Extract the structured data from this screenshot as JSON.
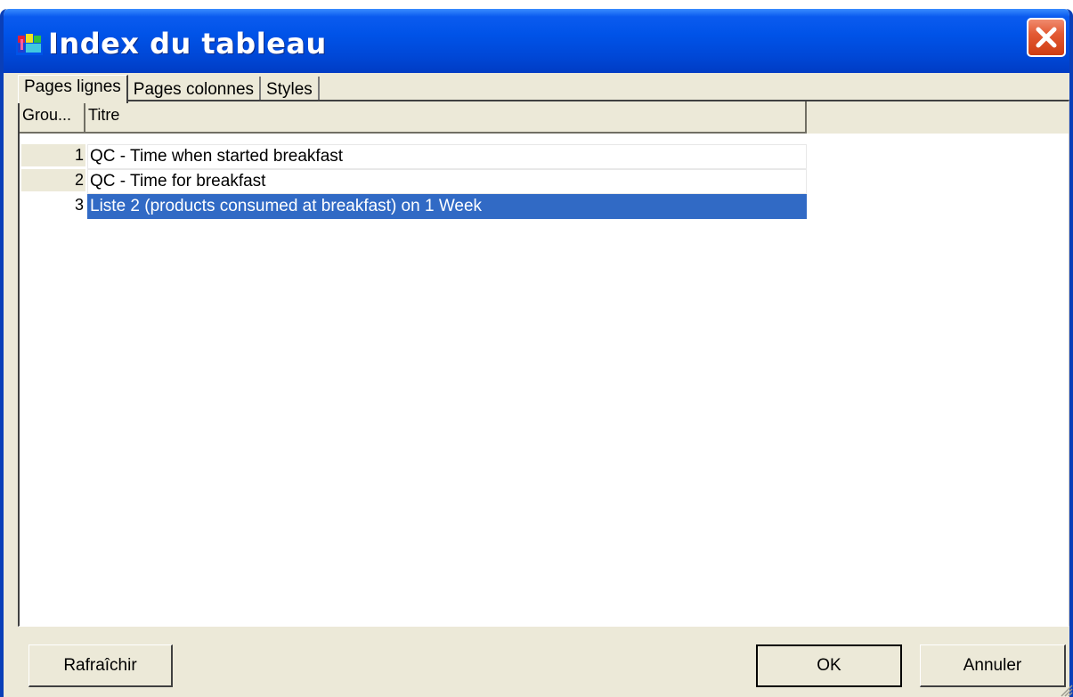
{
  "window": {
    "title": "Index du tableau",
    "accent": "#0053e8",
    "close_color": "#e35a34"
  },
  "tabs": [
    {
      "label": "Pages lignes",
      "active": true
    },
    {
      "label": "Pages colonnes",
      "active": false
    },
    {
      "label": "Styles",
      "active": false
    }
  ],
  "grid": {
    "columns": [
      "Grou...",
      "Titre"
    ],
    "rows": [
      {
        "group": "1",
        "title": "QC - Time when started breakfast",
        "selected": false
      },
      {
        "group": "2",
        "title": "QC - Time for breakfast",
        "selected": false
      },
      {
        "group": "3",
        "title": "Liste 2 (products consumed at breakfast) on 1 Week",
        "selected": true
      }
    ],
    "selection_color": "#316ac5"
  },
  "buttons": {
    "refresh": "Rafraîchir",
    "ok": "OK",
    "cancel": "Annuler"
  },
  "icons": {
    "app": "table-index-icon",
    "close": "close-icon",
    "resize": "resize-grip-icon"
  }
}
